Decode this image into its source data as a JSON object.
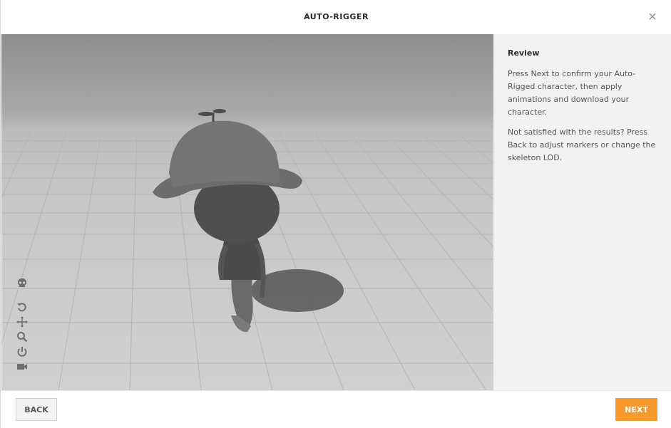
{
  "header": {
    "title": "AUTO-RIGGER",
    "close_symbol": "✕"
  },
  "panel": {
    "heading": "Review",
    "paragraph1": "Press Next to confirm your Auto-Rigged character, then apply animations and download your character.",
    "paragraph2": "Not satisfied with the results? Press Back to adjust markers or change the skeleton LOD."
  },
  "toolbar": {
    "icons": [
      "skull-icon",
      "undo-icon",
      "move-icon",
      "zoom-icon",
      "power-icon",
      "camera-icon"
    ]
  },
  "footer": {
    "back_label": "BACK",
    "next_label": "NEXT"
  },
  "colors": {
    "accent": "#f79a2e",
    "panel_bg": "#f2f2f2"
  }
}
